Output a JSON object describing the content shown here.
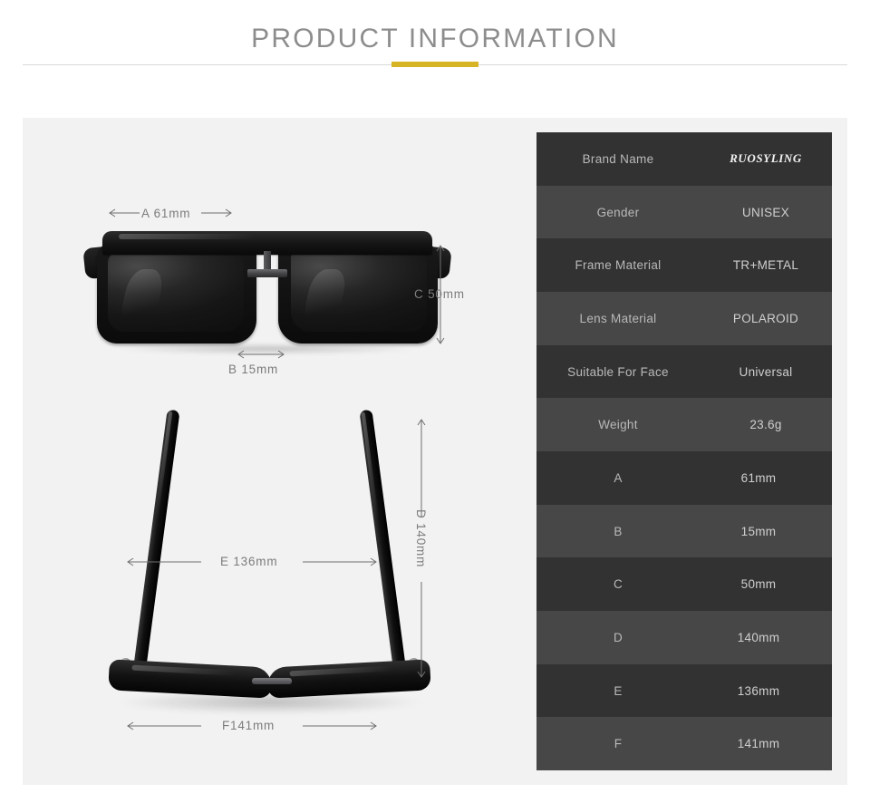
{
  "header": {
    "title": "PRODUCT INFORMATION",
    "accent_color": "#d6b426",
    "rule_color": "#d9d9d9"
  },
  "panel": {
    "background_color": "#f2f2f2"
  },
  "spec_table": {
    "row_dark_color": "#323232",
    "row_light_color": "#474747",
    "rows": [
      {
        "label": "Brand Name",
        "value": "RUOSYLING"
      },
      {
        "label": "Gender",
        "value": "UNISEX"
      },
      {
        "label": "Frame Material",
        "value": "TR+METAL"
      },
      {
        "label": "Lens Material",
        "value": "POLAROID"
      },
      {
        "label": "Suitable For Face",
        "value": "Universal"
      },
      {
        "label": "Weight",
        "value": "23.6g"
      },
      {
        "label": "A",
        "value": "61mm"
      },
      {
        "label": "B",
        "value": "15mm"
      },
      {
        "label": "C",
        "value": "50mm"
      },
      {
        "label": "D",
        "value": "140mm"
      },
      {
        "label": "E",
        "value": "136mm"
      },
      {
        "label": "F",
        "value": "141mm"
      }
    ]
  },
  "dimensions": {
    "a": "A 61mm",
    "b": "B 15mm",
    "c": "C 50mm",
    "d": "D 140mm",
    "e": "E 136mm",
    "f": "F141mm"
  },
  "product": {
    "front_view_name": "sunglasses-front-view",
    "top_view_name": "sunglasses-top-view"
  }
}
